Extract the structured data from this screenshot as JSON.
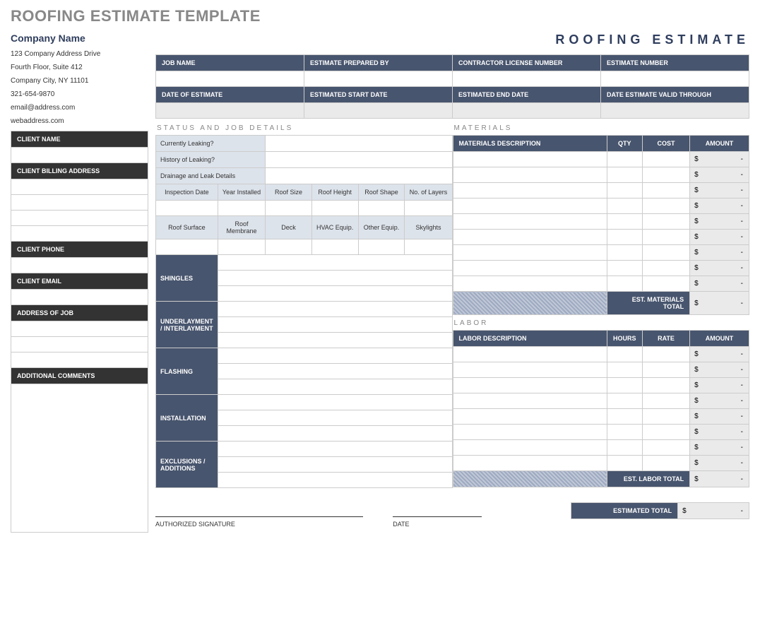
{
  "title": "ROOFING ESTIMATE TEMPLATE",
  "docLabel": "ROOFING ESTIMATE",
  "company": {
    "name": "Company Name",
    "addr1": "123 Company Address Drive",
    "addr2": "Fourth Floor, Suite 412",
    "addr3": "Company City, NY  11101",
    "phone": "321-654-9870",
    "email": "email@address.com",
    "web": "webaddress.com"
  },
  "jobHeaders": {
    "jobName": "JOB NAME",
    "prepBy": "ESTIMATE PREPARED BY",
    "license": "CONTRACTOR LICENSE NUMBER",
    "estNum": "ESTIMATE NUMBER",
    "dateEst": "DATE OF ESTIMATE",
    "startDate": "ESTIMATED START DATE",
    "endDate": "ESTIMATED END DATE",
    "validThru": "DATE ESTIMATE VALID THROUGH"
  },
  "client": {
    "name": "CLIENT NAME",
    "billing": "CLIENT BILLING ADDRESS",
    "phone": "CLIENT PHONE",
    "email": "CLIENT EMAIL",
    "jobAddr": "ADDRESS OF JOB",
    "comments": "ADDITIONAL COMMENTS"
  },
  "sections": {
    "status": "STATUS AND JOB DETAILS",
    "materials": "MATERIALS",
    "labor": "LABOR"
  },
  "status": {
    "leaking": "Currently Leaking?",
    "history": "History of Leaking?",
    "drainage": "Drainage and Leak Details",
    "inspDate": "Inspection Date",
    "yearInst": "Year Installed",
    "roofSize": "Roof Size",
    "roofHeight": "Roof Height",
    "roofShape": "Roof Shape",
    "layers": "No. of Layers",
    "surface": "Roof Surface",
    "membrane": "Roof Membrane",
    "deck": "Deck",
    "hvac": "HVAC Equip.",
    "other": "Other Equip.",
    "skylights": "Skylights"
  },
  "vlabels": {
    "shingles": "SHINGLES",
    "underlay": "UNDERLAYMENT / INTERLAYMENT",
    "flashing": "FLASHING",
    "install": "INSTALLATION",
    "excl": "EXCLUSIONS / ADDITIONS"
  },
  "materialsTable": {
    "desc": "MATERIALS DESCRIPTION",
    "qty": "QTY",
    "cost": "COST",
    "amount": "AMOUNT",
    "total": "EST. MATERIALS  TOTAL"
  },
  "laborTable": {
    "desc": "LABOR DESCRIPTION",
    "hours": "HOURS",
    "rate": "RATE",
    "amount": "AMOUNT",
    "total": "EST. LABOR TOTAL"
  },
  "footer": {
    "sig": "AUTHORIZED SIGNATURE",
    "date": "DATE",
    "estTotal": "ESTIMATED TOTAL"
  },
  "currency": "$"
}
